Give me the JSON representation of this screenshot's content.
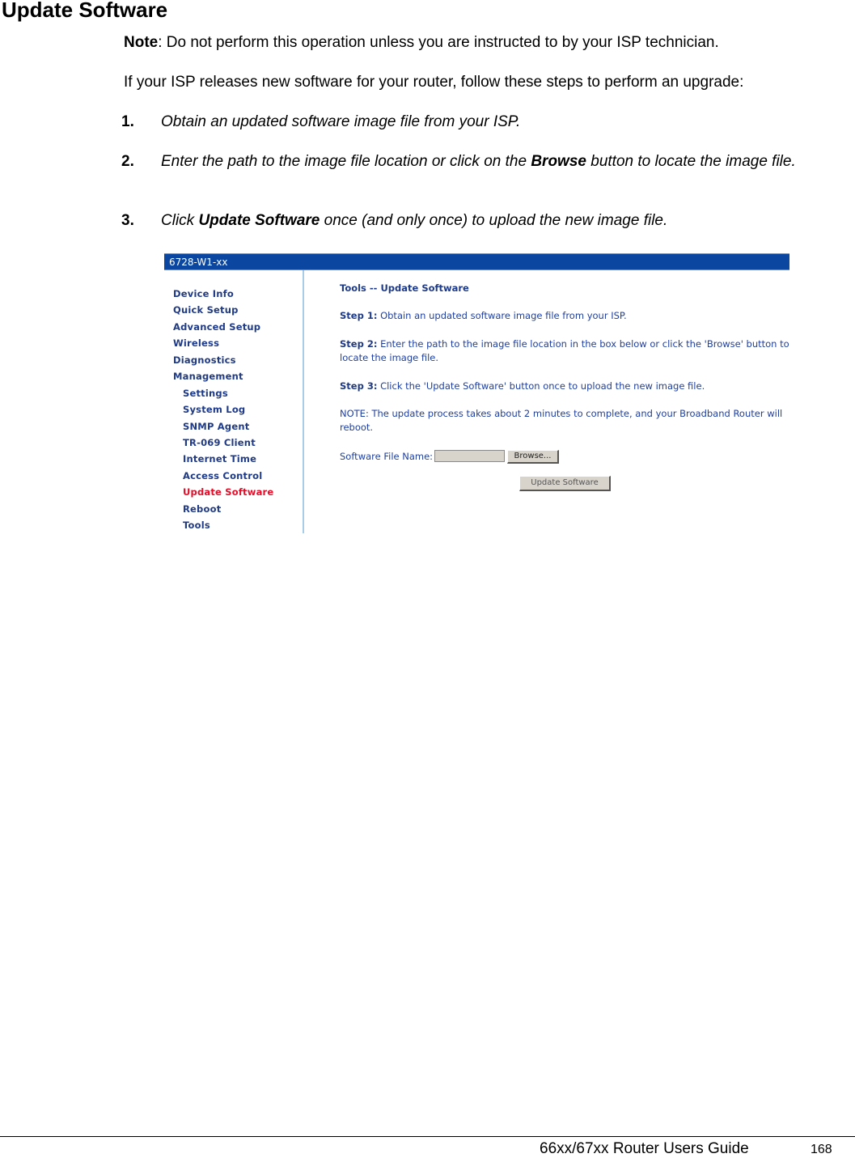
{
  "document": {
    "title": "Update Software",
    "note_label": "Note",
    "note_text": ": Do not perform this operation unless you are instructed to by your ISP technician.",
    "intro": "If your ISP releases new software for your router, follow these steps to perform an upgrade:",
    "steps": [
      {
        "number": "1.",
        "text": "Obtain an updated software image file from your ISP."
      },
      {
        "number": "2.",
        "text_before": "Enter the path to the image file location or click on the ",
        "bold": "Browse",
        "text_after": " button to locate the image file."
      },
      {
        "number": "3.",
        "text_before": "Click ",
        "bold": "Update Software",
        "text_after": " once (and only once) to upload the new image file."
      }
    ]
  },
  "router_ui": {
    "header_title": "6728-W1-xx",
    "accent_color": "#0b47a0",
    "active_color": "#e0102a",
    "nav": {
      "top_items": [
        "Device Info",
        "Quick Setup",
        "Advanced Setup",
        "Wireless",
        "Diagnostics",
        "Management"
      ],
      "sub_items": [
        "Settings",
        "System Log",
        "SNMP Agent",
        "TR-069 Client",
        "Internet Time",
        "Access Control",
        "Update Software",
        "Reboot",
        "Tools"
      ],
      "active_item": "Update Software"
    },
    "content": {
      "heading": "Tools -- Update Software",
      "step1_label": "Step 1:",
      "step1_text": " Obtain an updated software image file from your ISP.",
      "step2_label": "Step 2:",
      "step2_line1": " Enter the path to the image file location in the box below or click the 'Browse' button to",
      "step2_line2": "locate the image file.",
      "step3_label": "Step 3:",
      "step3_text": " Click the 'Update Software' button once to upload the new image file.",
      "note_line1": "NOTE: The update process takes about 2 minutes to complete, and your Broadband Router will",
      "note_line2": "reboot.",
      "file_label": "Software File Name:",
      "file_value": "",
      "browse_label": "Browse...",
      "update_label": "Update Software"
    }
  },
  "footer": {
    "guide_title": "66xx/67xx Router Users Guide",
    "page_number": "168"
  }
}
